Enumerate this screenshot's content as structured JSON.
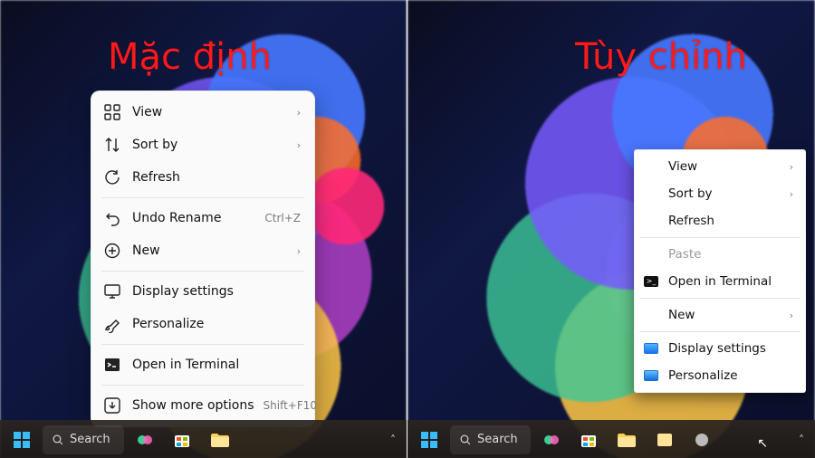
{
  "titles": {
    "left": "Mặc định",
    "right": "Tùy chỉnh"
  },
  "search_label": "Search",
  "left_menu": {
    "view": "View",
    "sort": "Sort by",
    "refresh": "Refresh",
    "undo": "Undo Rename",
    "undo_accel": "Ctrl+Z",
    "new": "New",
    "display": "Display settings",
    "personalize": "Personalize",
    "terminal": "Open in Terminal",
    "more": "Show more options",
    "more_accel": "Shift+F10"
  },
  "right_menu": {
    "view": "View",
    "sort": "Sort by",
    "refresh": "Refresh",
    "paste": "Paste",
    "terminal": "Open in Terminal",
    "new": "New",
    "display": "Display settings",
    "personalize": "Personalize"
  }
}
